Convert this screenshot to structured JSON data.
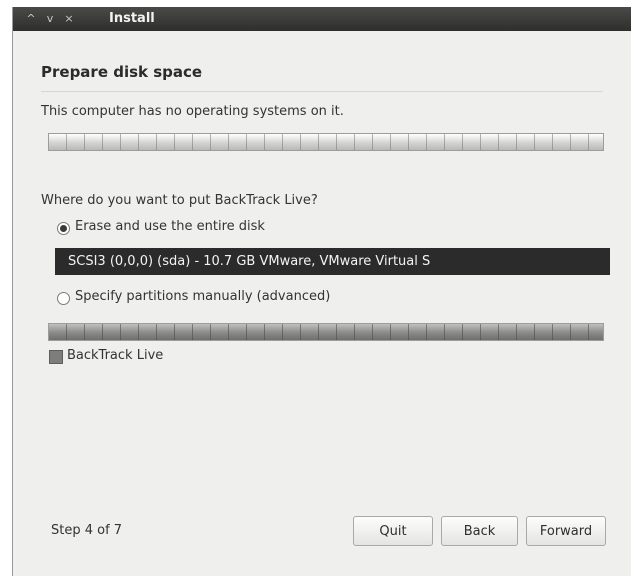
{
  "window": {
    "title": "Install",
    "controls": {
      "up": "^",
      "down": "v",
      "close": "×"
    }
  },
  "page": {
    "heading": "Prepare disk space",
    "status": "This computer has no operating systems on it.",
    "question": "Where do you want to put BackTrack Live?"
  },
  "options": {
    "erase": {
      "label": "Erase and use the entire disk",
      "selected": true
    },
    "disk_selection": "SCSI3 (0,0,0) (sda) - 10.7 GB VMware, VMware Virtual S",
    "manual": {
      "label": "Specify partitions manually (advanced)",
      "selected": false
    }
  },
  "partition_legend": {
    "label": "BackTrack Live",
    "color": "#7d7d7b"
  },
  "footer": {
    "step": "Step 4 of 7",
    "quit": "Quit",
    "back": "Back",
    "forward": "Forward"
  }
}
